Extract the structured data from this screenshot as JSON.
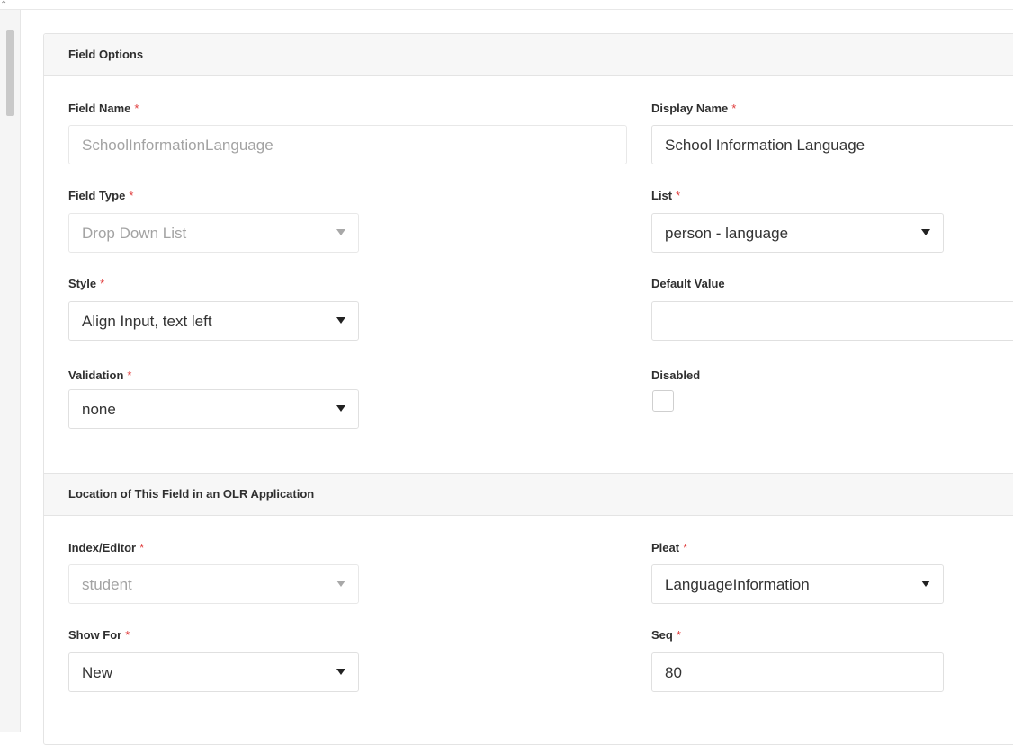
{
  "sections": {
    "field_options": "Field Options",
    "location": "Location of This Field in an OLR Application"
  },
  "fields": {
    "field_name": {
      "label": "Field Name",
      "value": "SchoolInformationLanguage",
      "disabled": true
    },
    "display_name": {
      "label": "Display Name",
      "value": "School Information Language"
    },
    "field_type": {
      "label": "Field Type",
      "value": "Drop Down List",
      "disabled": true
    },
    "list": {
      "label": "List",
      "value": "person - language"
    },
    "style": {
      "label": "Style",
      "value": "Align Input, text left"
    },
    "default_value": {
      "label": "Default Value",
      "value": ""
    },
    "validation": {
      "label": "Validation",
      "value": "none"
    },
    "disabled": {
      "label": "Disabled",
      "checked": false
    },
    "index_editor": {
      "label": "Index/Editor",
      "value": "student",
      "disabled": true
    },
    "pleat": {
      "label": "Pleat",
      "value": "LanguageInformation"
    },
    "show_for": {
      "label": "Show For",
      "value": "New"
    },
    "seq": {
      "label": "Seq",
      "value": "80"
    }
  },
  "required_marker": "*",
  "colors": {
    "required": "#e03c3c",
    "border": "#e0e0e0",
    "header_bg": "#f7f7f7",
    "disabled_text": "#a3a3a3"
  }
}
